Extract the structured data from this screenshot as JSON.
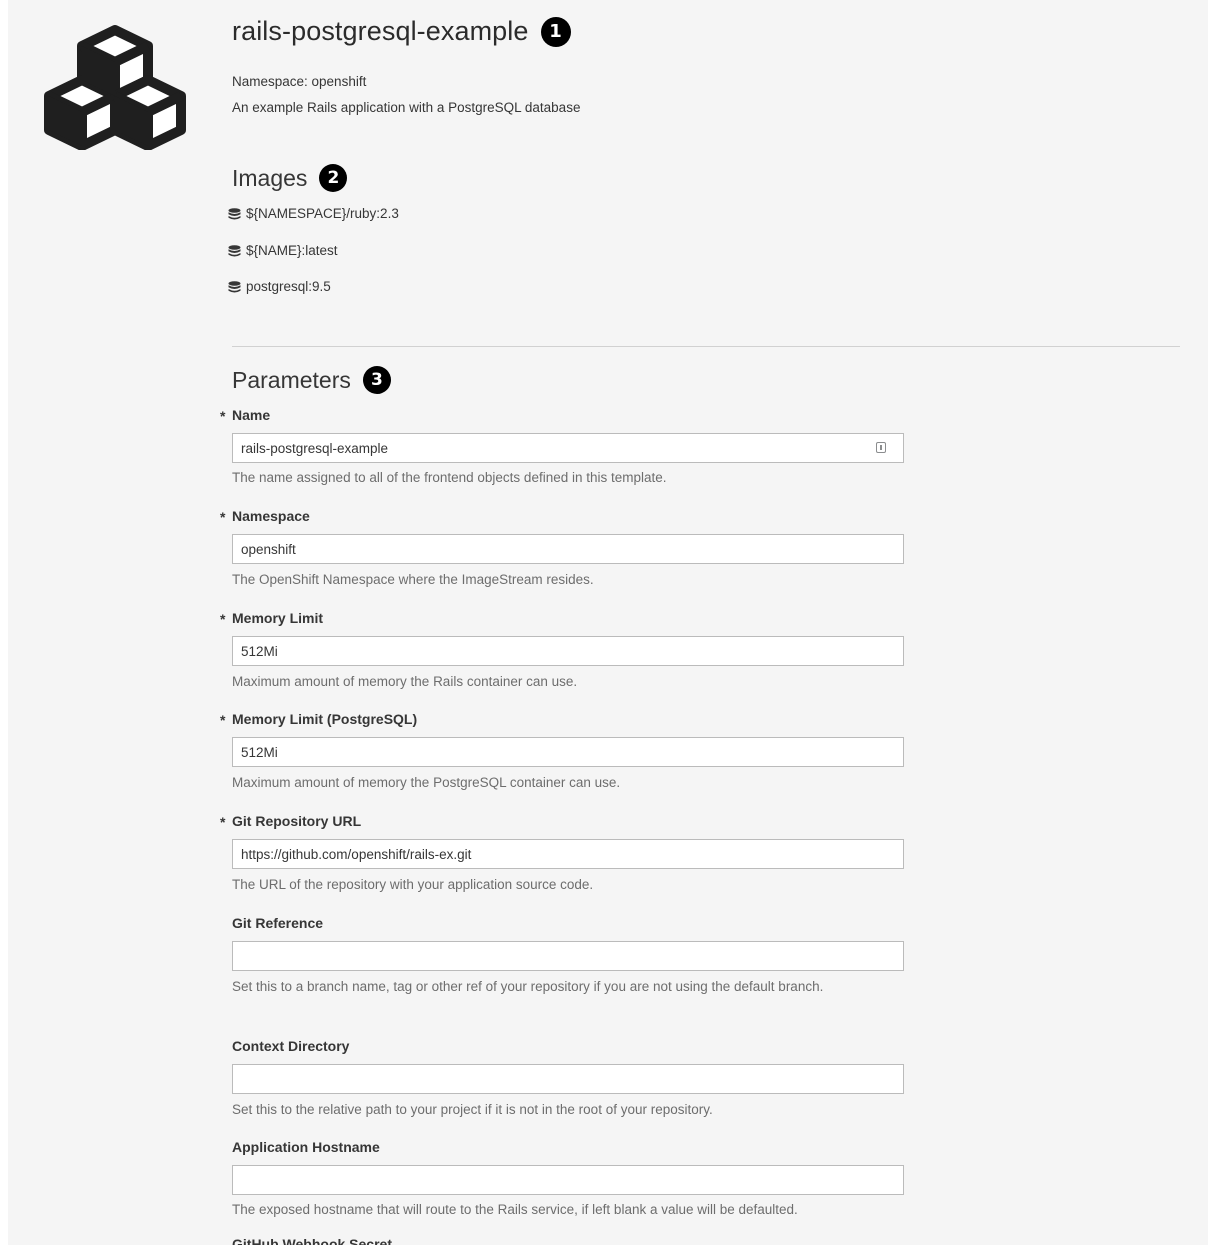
{
  "template": {
    "title": "rails-postgresql-example",
    "namespace_line": "Namespace: openshift",
    "description": "An example Rails application with a PostgreSQL database",
    "logo_icon": "cubes-icon"
  },
  "callouts": [
    "1",
    "2",
    "3"
  ],
  "images": {
    "heading": "Images",
    "items": [
      {
        "name": "${NAMESPACE}/ruby:2.3",
        "icon": "database-icon"
      },
      {
        "name": "${NAME}:latest",
        "icon": "database-icon"
      },
      {
        "name": "postgresql:9.5",
        "icon": "database-icon"
      }
    ]
  },
  "parameters": {
    "heading": "Parameters",
    "fields": [
      {
        "label": "Name",
        "required": true,
        "value": "rails-postgresql-example",
        "help": "The name assigned to all of the frontend objects defined in this template."
      },
      {
        "label": "Namespace",
        "required": true,
        "value": "openshift",
        "help": "The OpenShift Namespace where the ImageStream resides."
      },
      {
        "label": "Memory Limit",
        "required": true,
        "value": "512Mi",
        "help": "Maximum amount of memory the Rails container can use."
      },
      {
        "label": "Memory Limit (PostgreSQL)",
        "required": true,
        "value": "512Mi",
        "help": "Maximum amount of memory the PostgreSQL container can use."
      },
      {
        "label": "Git Repository URL",
        "required": true,
        "value": "https://github.com/openshift/rails-ex.git",
        "help": "The URL of the repository with your application source code."
      },
      {
        "label": "Git Reference",
        "required": false,
        "value": "",
        "help": "Set this to a branch name, tag or other ref of your repository if you are not using the default branch."
      },
      {
        "label": "Context Directory",
        "required": false,
        "value": "",
        "help": "Set this to the relative path to your project if it is not in the root of your repository."
      },
      {
        "label": "Application Hostname",
        "required": false,
        "value": "",
        "help": "The exposed hostname that will route to the Rails service, if left blank a value will be defaulted."
      }
    ],
    "required_marker": "*",
    "next_label_partial": "GitHub Webhook Secret"
  },
  "colors": {
    "page_bg": "#f5f5f5",
    "field_border": "#bbbbbb",
    "help_text": "#6d6d6d",
    "callout_bg": "#000000"
  }
}
